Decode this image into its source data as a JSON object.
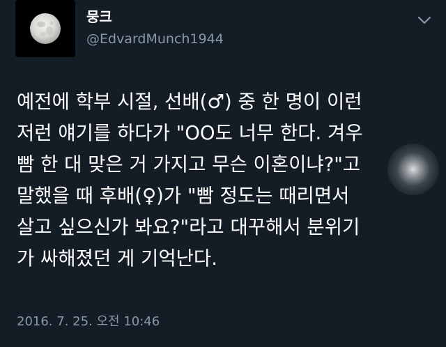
{
  "user": {
    "display_name": "뭉크",
    "handle": "@EdvardMunch1944"
  },
  "tweet": {
    "lines": [
      "예전에 학부 시절, 선배(♂) 중 한 명이 이런",
      "저런 얘기를 하다가 \"OO도 너무 한다. 겨우",
      "빰 한 대 맞은 거 가지고 무슨 이혼이냐?\"고",
      "말했을 때 후배(♀)가 \"빰 정도는 때리면서",
      "살고 싶으신가 봐요?\"라고 대꾸해서 분위기",
      "가 싸해졌던 게 기억난다."
    ],
    "timestamp": "2016. 7. 25. 오전 10:46"
  },
  "icons": {
    "avatar": "full-moon-icon",
    "menu": "chevron-down-icon"
  },
  "colors": {
    "background": "#141d26",
    "primary_text": "#ffffff",
    "secondary_text": "#8899a6"
  }
}
